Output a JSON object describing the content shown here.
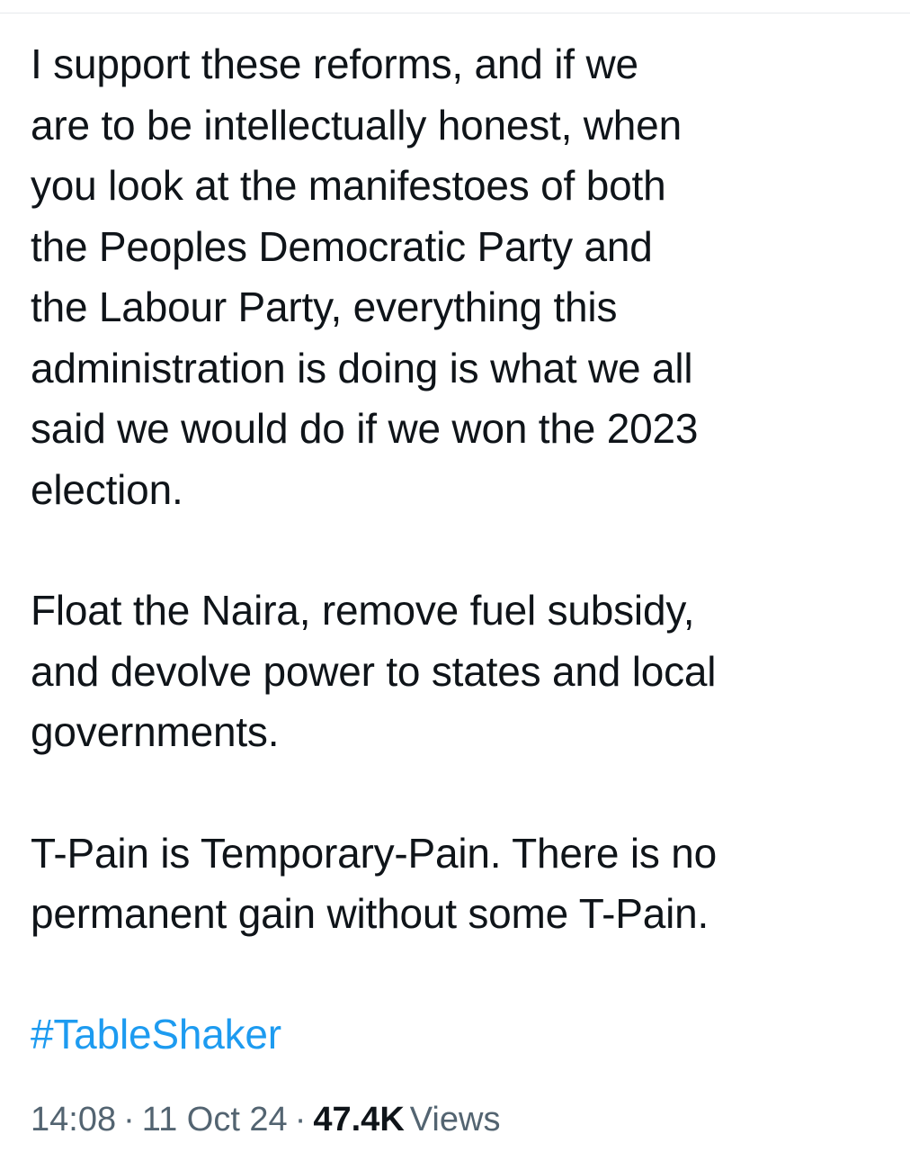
{
  "tweet": {
    "paragraphs": [
      [
        "I support these reforms, and if we",
        "are to be intellectually honest, when",
        "you look at the manifestoes of both",
        "the Peoples Democratic Party and",
        "the Labour Party, everything this",
        "administration is doing is what we all",
        "said we would do if we won the 2023",
        "election."
      ],
      [
        "Float the Naira, remove fuel subsidy,",
        "and devolve power to states and local",
        "governments."
      ],
      [
        "T-Pain is Temporary-Pain. There is no",
        "permanent gain without some T-Pain."
      ]
    ],
    "hashtag": "#TableShaker"
  },
  "meta": {
    "time": "14:08",
    "separator": "·",
    "date": "11 Oct 24",
    "views_count": "47.4K",
    "views_label": "Views"
  },
  "colors": {
    "text": "#0f1419",
    "link": "#1d9bf0",
    "muted": "#536471",
    "divider": "#e6e9ec"
  }
}
